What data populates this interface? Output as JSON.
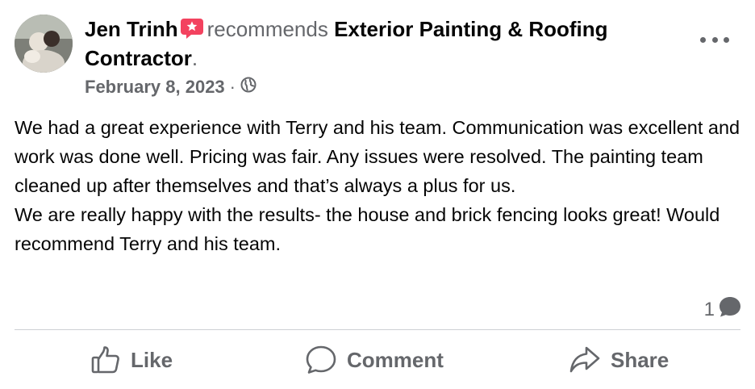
{
  "author": {
    "name": "Jen Trinh"
  },
  "header": {
    "verb": "recommends",
    "page_name": "Exterior Painting & Roofing Contractor",
    "period": "."
  },
  "meta": {
    "date": "February 8, 2023",
    "separator": "·",
    "privacy_icon": "globe-icon"
  },
  "post": {
    "paragraphs": [
      "We had a great experience with Terry and his team. Communication was excellent and work was done well. Pricing was fair. Any issues were resolved. The painting team cleaned up after themselves and that’s always a plus for us.",
      "We are really happy with the results- the house and brick fencing looks great! Would recommend Terry and his team."
    ]
  },
  "stats": {
    "comment_count": "1"
  },
  "actions": {
    "like": "Like",
    "comment": "Comment",
    "share": "Share"
  },
  "colors": {
    "recommend_badge": "#f3425f",
    "secondary_text": "#65676b",
    "divider": "#ced0d4"
  }
}
